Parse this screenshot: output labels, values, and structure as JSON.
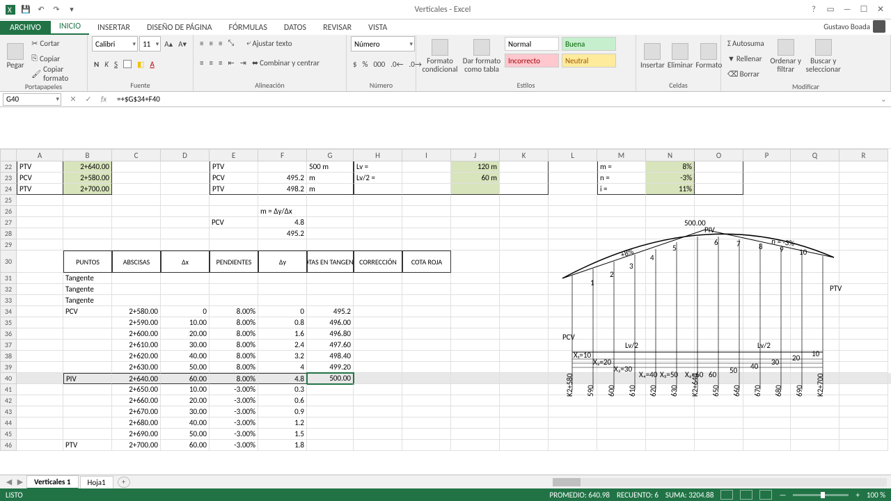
{
  "title": "Verticales - Excel",
  "user": "Gustavo Boada",
  "file_tab": "ARCHIVO",
  "ribbon_tabs": [
    "INICIO",
    "INSERTAR",
    "DISEÑO DE PÁGINA",
    "FÓRMULAS",
    "DATOS",
    "REVISAR",
    "VISTA"
  ],
  "clipboard": {
    "paste": "Pegar",
    "cut": "Cortar",
    "copy": "Copiar",
    "brush": "Copiar formato",
    "label": "Portapapeles"
  },
  "font": {
    "name": "Calibri",
    "size": "11",
    "label": "Fuente"
  },
  "align": {
    "wrap": "Ajustar texto",
    "merge": "Combinar y centrar",
    "label": "Alineación"
  },
  "number": {
    "fmt": "Número",
    "label": "Número"
  },
  "styles": {
    "cond": "Formato condicional",
    "table": "Dar formato como tabla",
    "normal": "Normal",
    "buena": "Buena",
    "incorrecto": "Incorrecto",
    "neutral": "Neutral",
    "label": "Estilos"
  },
  "cells": {
    "insert": "Insertar",
    "delete": "Eliminar",
    "format": "Formato",
    "label": "Celdas"
  },
  "editing": {
    "autosum": "Autosuma",
    "fill": "Rellenar",
    "clear": "Borrar",
    "sort": "Ordenar y filtrar",
    "find": "Buscar y seleccionar",
    "label": "Modificar"
  },
  "name_box": "G40",
  "formula": "=+$G$34+F40",
  "cols": {
    "A": 67,
    "B": 70,
    "C": 70,
    "D": 70,
    "E": 70,
    "F": 70,
    "G": 67,
    "H": 70,
    "I": 70,
    "J": 70,
    "K": 70,
    "L": 70,
    "M": 70,
    "N": 70,
    "O": 70,
    "P": 68,
    "Q": 70,
    "R": 70
  },
  "rows_start": 22,
  "rows_end": 46,
  "table": {
    "r22": {
      "A": "PTV",
      "B": "2+640.00",
      "E": "PTV",
      "G": "500 m",
      "H": "Lv =",
      "J": "120 m",
      "M": "m =",
      "N": "8%"
    },
    "r23": {
      "A": "PCV",
      "B": "2+580.00",
      "E": "PCV",
      "F": "495.2",
      "G": "m",
      "H": "Lv/2 =",
      "J": "60 m",
      "M": "n =",
      "N": "-3%"
    },
    "r24": {
      "A": "PTV",
      "B": "2+700.00",
      "E": "PTV",
      "F": "498.2",
      "G": "m",
      "M": "i =",
      "N": "11%"
    }
  },
  "m_formula": "m = Δy/Δx",
  "pcv_label": "PCV",
  "pcv_vals": [
    "4.8",
    "495.2"
  ],
  "headers": [
    "PUNTOS",
    "ABSCISAS",
    "Δx",
    "PENDIENTES",
    "Δy",
    "COTAS EN TANGENTE",
    "CORRECCIÓN",
    "COTA ROJA"
  ],
  "data_rows": [
    {
      "B": "Tangente"
    },
    {
      "B": "Tangente"
    },
    {
      "B": "Tangente"
    },
    {
      "B": "PCV",
      "C": "2+580.00",
      "D": "0",
      "E": "8.00%",
      "F": "0",
      "G": "495.2"
    },
    {
      "C": "2+590.00",
      "D": "10.00",
      "E": "8.00%",
      "F": "0.8",
      "G": "496.00"
    },
    {
      "C": "2+600.00",
      "D": "20.00",
      "E": "8.00%",
      "F": "1.6",
      "G": "496.80"
    },
    {
      "C": "2+610.00",
      "D": "30.00",
      "E": "8.00%",
      "F": "2.4",
      "G": "497.60"
    },
    {
      "C": "2+620.00",
      "D": "40.00",
      "E": "8.00%",
      "F": "3.2",
      "G": "498.40"
    },
    {
      "C": "2+630.00",
      "D": "50.00",
      "E": "8.00%",
      "F": "4",
      "G": "499.20"
    },
    {
      "B": "PIV",
      "C": "2+640.00",
      "D": "60.00",
      "E": "8.00%",
      "F": "4.8",
      "G": "500.00",
      "sel": true
    },
    {
      "C": "2+650.00",
      "D": "10.00",
      "E": "-3.00%",
      "F": "0.3"
    },
    {
      "C": "2+660.00",
      "D": "20.00",
      "E": "-3.00%",
      "F": "0.6"
    },
    {
      "C": "2+670.00",
      "D": "30.00",
      "E": "-3.00%",
      "F": "0.9"
    },
    {
      "C": "2+680.00",
      "D": "40.00",
      "E": "-3.00%",
      "F": "1.2"
    },
    {
      "C": "2+690.00",
      "D": "50.00",
      "E": "-3.00%",
      "F": "1.5"
    },
    {
      "B": "PTV",
      "C": "2+700.00",
      "D": "60.00",
      "E": "-3.00%",
      "F": "1.8"
    }
  ],
  "sheet_tabs": [
    "Verticales 1",
    "Hoja1"
  ],
  "status": {
    "ready": "LISTO",
    "avg_label": "PROMEDIO:",
    "avg": "640.98",
    "count_label": "RECUENTO:",
    "count": "6",
    "sum_label": "SUMA:",
    "sum": "3204.88",
    "zoom": "100 %"
  },
  "chart_data": {
    "type": "line",
    "title": "",
    "piv_label": "PIV",
    "pcv_label": "PCV",
    "ptv_label": "PTV",
    "piv_elev": "500.00",
    "m": "+8%",
    "n": "-3%",
    "lv2": "Lv/2",
    "stations": [
      "K2+580",
      "590",
      "600",
      "610",
      "620",
      "630",
      "K2+640",
      "650",
      "660",
      "670",
      "680",
      "690",
      "K2+700"
    ],
    "ticks": [
      1,
      2,
      3,
      4,
      5,
      6,
      7,
      8,
      9,
      10
    ],
    "profile": [
      [
        0,
        80
      ],
      [
        40,
        60
      ],
      [
        80,
        44
      ],
      [
        120,
        32
      ],
      [
        160,
        22
      ],
      [
        200,
        14
      ],
      [
        225,
        10
      ],
      [
        250,
        14
      ],
      [
        290,
        22
      ],
      [
        330,
        34
      ],
      [
        370,
        50
      ],
      [
        400,
        64
      ]
    ]
  }
}
